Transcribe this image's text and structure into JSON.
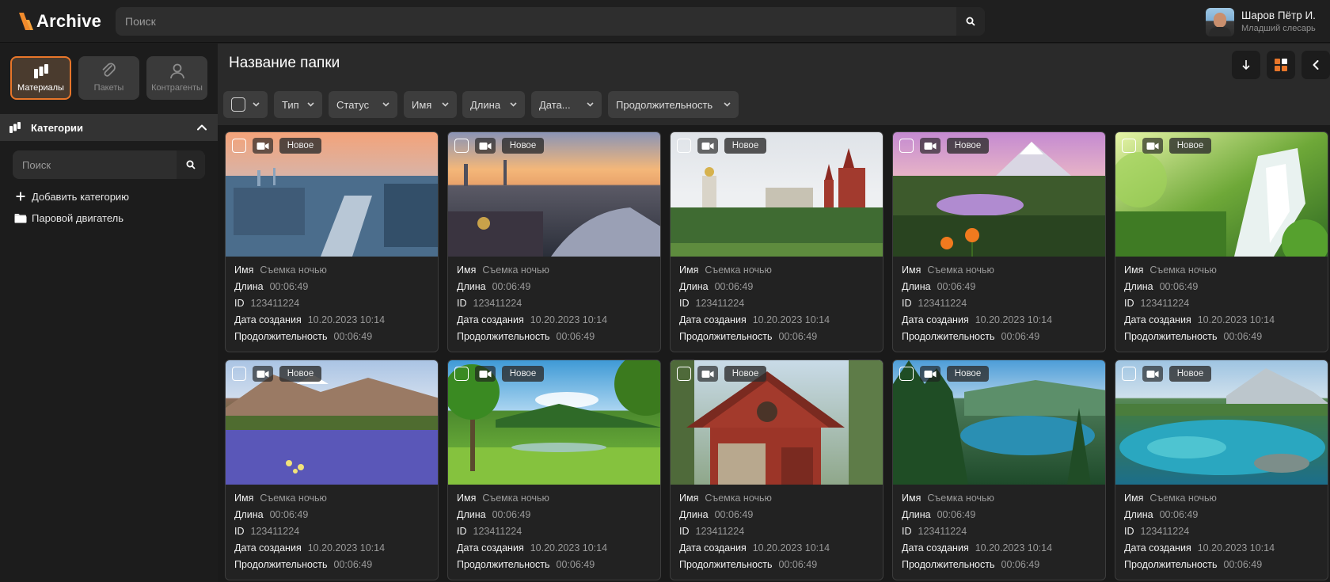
{
  "app": {
    "logo_text": "Archive",
    "brand_color": "#e8762a"
  },
  "header": {
    "search_placeholder": "Поиск",
    "user": {
      "name": "Шаров Пётр И.",
      "role": "Младший слесарь"
    }
  },
  "sidebar": {
    "nav": [
      {
        "label": "Материалы",
        "icon": "layers-icon",
        "active": true
      },
      {
        "label": "Пакеты",
        "icon": "paperclip-icon",
        "active": false
      },
      {
        "label": "Контрагенты",
        "icon": "person-icon",
        "active": false
      }
    ],
    "categories_label": "Категории",
    "search_placeholder": "Поиск",
    "add_category_label": "Добавить категорию",
    "folders": [
      {
        "label": "Паровой двигатель"
      }
    ]
  },
  "main": {
    "folder_title": "Название папки",
    "filters": [
      {
        "label": "Тип"
      },
      {
        "label": "Статус"
      },
      {
        "label": "Имя"
      },
      {
        "label": "Длина"
      },
      {
        "label": "Дата..."
      },
      {
        "label": "Продолжительность"
      }
    ],
    "field_labels": {
      "name": "Имя",
      "length": "Длина",
      "id": "ID",
      "created": "Дата создания",
      "duration": "Продолжительность"
    },
    "items": [
      {
        "badge": "Новое",
        "name": "Съемка ночью",
        "length": "00:06:49",
        "id": "123411224",
        "created": "10.20.2023 10:14",
        "duration": "00:06:49",
        "scene": "city-river"
      },
      {
        "badge": "Новое",
        "name": "Съемка ночью",
        "length": "00:06:49",
        "id": "123411224",
        "created": "10.20.2023 10:14",
        "duration": "00:06:49",
        "scene": "city-sunset"
      },
      {
        "badge": "Новое",
        "name": "Съемка ночью",
        "length": "00:06:49",
        "id": "123411224",
        "created": "10.20.2023 10:14",
        "duration": "00:06:49",
        "scene": "kremlin"
      },
      {
        "badge": "Новое",
        "name": "Съемка ночью",
        "length": "00:06:49",
        "id": "123411224",
        "created": "10.20.2023 10:14",
        "duration": "00:06:49",
        "scene": "mountain-lake-pink"
      },
      {
        "badge": "Новое",
        "name": "Съемка ночью",
        "length": "00:06:49",
        "id": "123411224",
        "created": "10.20.2023 10:14",
        "duration": "00:06:49",
        "scene": "waterfall"
      },
      {
        "badge": "Новое",
        "name": "Съемка ночью",
        "length": "00:06:49",
        "id": "123411224",
        "created": "10.20.2023 10:14",
        "duration": "00:06:49",
        "scene": "lupine-meadow"
      },
      {
        "badge": "Новое",
        "name": "Съемка ночью",
        "length": "00:06:49",
        "id": "123411224",
        "created": "10.20.2023 10:14",
        "duration": "00:06:49",
        "scene": "green-valley"
      },
      {
        "badge": "Новое",
        "name": "Съемка ночью",
        "length": "00:06:49",
        "id": "123411224",
        "created": "10.20.2023 10:14",
        "duration": "00:06:49",
        "scene": "red-cabin"
      },
      {
        "badge": "Новое",
        "name": "Съемка ночью",
        "length": "00:06:49",
        "id": "123411224",
        "created": "10.20.2023 10:14",
        "duration": "00:06:49",
        "scene": "forest-lake"
      },
      {
        "badge": "Новое",
        "name": "Съемка ночью",
        "length": "00:06:49",
        "id": "123411224",
        "created": "10.20.2023 10:14",
        "duration": "00:06:49",
        "scene": "clear-lake"
      }
    ]
  }
}
